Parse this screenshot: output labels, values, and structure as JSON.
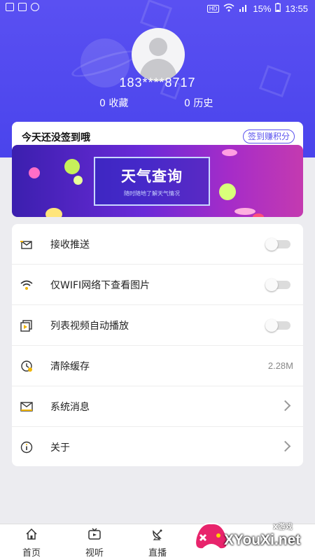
{
  "status_bar": {
    "battery": "15%",
    "time": "13:55",
    "hd": "HD"
  },
  "profile": {
    "phone": "183****8717",
    "favorites": "0 收藏",
    "history": "0 历史"
  },
  "signin": {
    "text": "今天还没签到哦",
    "button": "签到赚积分"
  },
  "banner": {
    "title": "天气查询",
    "subtitle": "随时随地了解天气情况"
  },
  "settings": [
    {
      "icon": "envelope-icon",
      "label": "接收推送",
      "control": "toggle",
      "on": false
    },
    {
      "icon": "wifi-icon",
      "label": "仅WIFI网络下查看图片",
      "control": "toggle",
      "on": false
    },
    {
      "icon": "video-icon",
      "label": "列表视频自动播放",
      "control": "toggle",
      "on": false
    },
    {
      "icon": "clock-icon",
      "label": "清除缓存",
      "control": "value",
      "value": "2.28M"
    },
    {
      "icon": "mail-icon",
      "label": "系统消息",
      "control": "chevron"
    },
    {
      "icon": "info-icon",
      "label": "关于",
      "control": "chevron"
    }
  ],
  "tabs": [
    {
      "icon": "home-icon",
      "label": "首页"
    },
    {
      "icon": "tv-icon",
      "label": "视听"
    },
    {
      "icon": "satellite-icon",
      "label": "直播"
    }
  ],
  "watermark": {
    "text": "XYouXi.net",
    "small": "X游戏"
  },
  "colors": {
    "header": "#5a50f2",
    "accent": "#5a52ee"
  }
}
